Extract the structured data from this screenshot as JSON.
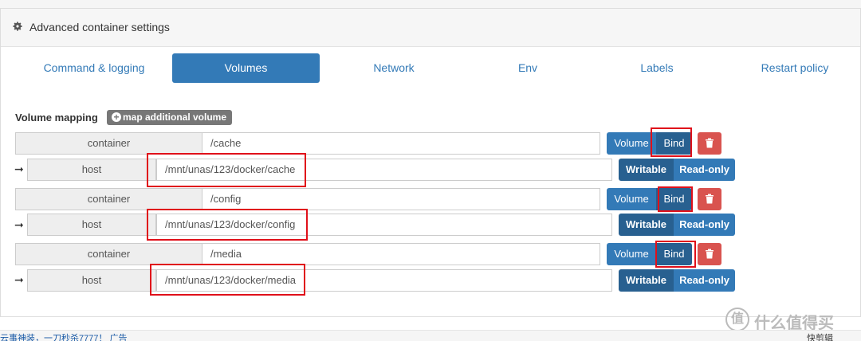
{
  "header": {
    "title": "Advanced container settings",
    "icon": "gear-icon"
  },
  "tabs": [
    {
      "label": "Command & logging",
      "active": false
    },
    {
      "label": "Volumes",
      "active": true
    },
    {
      "label": "Network",
      "active": false
    },
    {
      "label": "Env",
      "active": false
    },
    {
      "label": "Labels",
      "active": false
    },
    {
      "label": "Restart policy",
      "active": false
    }
  ],
  "volumes": {
    "label": "Volume mapping",
    "add_button": "map additional volume",
    "container_addon": "container",
    "host_addon": "host",
    "volume_btn": "Volume",
    "bind_btn": "Bind",
    "writable_btn": "Writable",
    "readonly_btn": "Read-only",
    "mappings": [
      {
        "container": "/cache",
        "host": "/mnt/unas/123/docker/cache"
      },
      {
        "container": "/config",
        "host": "/mnt/unas/123/docker/config"
      },
      {
        "container": "/media",
        "host": "/mnt/unas/123/docker/media"
      }
    ]
  },
  "colors": {
    "primary": "#337ab7",
    "primary_dark": "#286090",
    "danger": "#d9534f",
    "highlight": "#e0101a"
  },
  "footer": {
    "left_text": "云事神装，一刀秒杀7777！ 广告",
    "right_text": "快剪辑"
  },
  "watermark": "值 什么值得买"
}
